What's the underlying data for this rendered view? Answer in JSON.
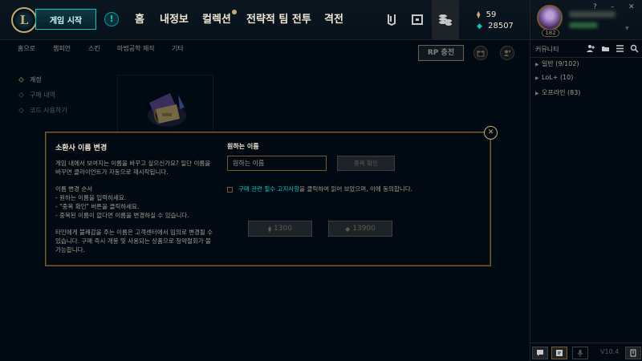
{
  "topbar": {
    "logo_glyph": "L",
    "play_label": "게임 시작",
    "alert_glyph": "!",
    "nav": [
      "홈",
      "내정보",
      "컬렉션",
      "전략적 팀 전투",
      "격전"
    ],
    "icons": [
      "mission-icon",
      "loot-chest-icon",
      "store-icon"
    ]
  },
  "currency": {
    "be": "59",
    "rp": "28507"
  },
  "profile": {
    "level": "182"
  },
  "window_controls": [
    "?",
    "–",
    "✕"
  ],
  "subnav": {
    "items": [
      "홈으로",
      "챔피언",
      "스킨",
      "마법공학 제작",
      "기타"
    ],
    "rp_button": "RP 충전"
  },
  "sidebar": {
    "items": [
      "계정",
      "구매 내역",
      "코드 사용하기"
    ]
  },
  "social": {
    "title": "커뮤니티",
    "groups": [
      "일반 (9/102)",
      "LoL+ (10)",
      "오프라인 (83)"
    ],
    "version": "V10.4"
  },
  "modal": {
    "title": "소환사 이름 변경",
    "intro": "게임 내에서 보여지는 이름을 바꾸고 싶으신가요? 일단 이름을 바꾸면 클라이언트가 자동으로 재시작됩니다.",
    "steps_title": "이름 변경 순서",
    "steps": [
      "- 원하는 이름을 입력하세요.",
      "- \"중복 확인\" 버튼을 클릭하세요.",
      "- 중복된 이름이 없다면 이름을 변경하실 수 있습니다."
    ],
    "warning": "타인에게 불쾌감을 주는 이름은 고객센터에서 임의로 변경될 수 있습니다. 구매 즉시 개봉 및 사용되는 상품으로 청약철회가 불가능합니다.",
    "field_label": "원하는 이름",
    "input_placeholder": "원하는 이름",
    "input_value": "",
    "check_button": "중복 확인",
    "agree_link": "구매 관련 필수 고지사항",
    "agree_rest": "을 클릭하여 읽어 보았으며, 이에 동의합니다.",
    "price_be": "1300",
    "price_rp": "13900",
    "close_glyph": "✕"
  },
  "colors": {
    "gold": "#c8aa6e",
    "teal": "#0ac8b9",
    "background": "#010a13"
  }
}
